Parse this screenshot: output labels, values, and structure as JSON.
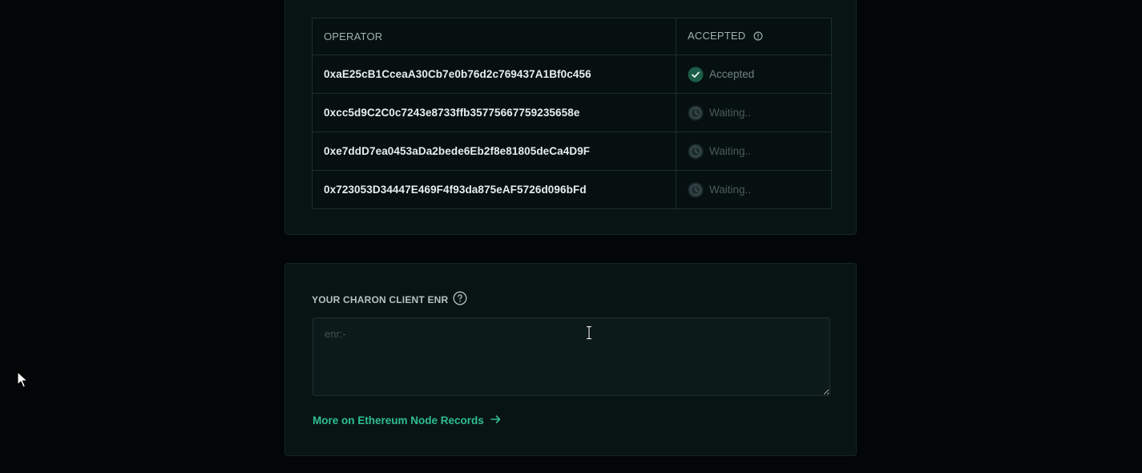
{
  "cluster_card": {
    "cut_title": "",
    "table": {
      "headers": {
        "operator": "OPERATOR",
        "accepted": "ACCEPTED"
      },
      "rows": [
        {
          "operator": "0xaE25cB1CceaA30Cb7e0b76d2c769437A1Bf0c456",
          "status": "Accepted",
          "state": "accepted"
        },
        {
          "operator": "0xcc5d9C2C0c7243e8733ffb35775667759235658e",
          "status": "Waiting..",
          "state": "waiting"
        },
        {
          "operator": "0xe7ddD7ea0453aDa2bede6Eb2f8e81805deCa4D9F",
          "status": "Waiting..",
          "state": "waiting"
        },
        {
          "operator": "0x723053D34447E469F4f93da875eAF5726d096bFd",
          "status": "Waiting..",
          "state": "waiting"
        }
      ]
    }
  },
  "enr_card": {
    "label": "YOUR CHARON CLIENT ENR",
    "input": {
      "placeholder": "enr:-",
      "value": ""
    },
    "link_label": "More on Ethereum Node Records"
  },
  "colors": {
    "accent": "#2fbf8e",
    "background": "#020606",
    "card": "#081414"
  },
  "icons": {
    "info": "info-circle-icon",
    "accepted": "check-circle-icon",
    "waiting": "clock-icon",
    "help": "question-circle-icon",
    "arrow": "arrow-right-icon"
  }
}
